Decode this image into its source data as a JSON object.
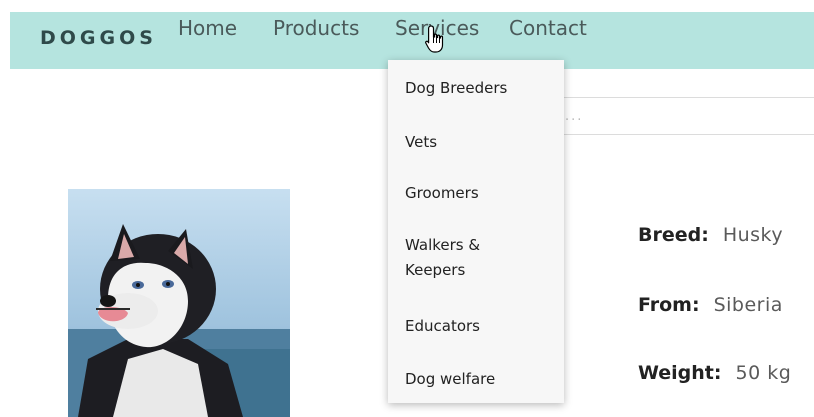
{
  "navbar": {
    "brand": "DOGGOS",
    "links": [
      "Home",
      "Products",
      "Services",
      "Contact"
    ]
  },
  "search": {
    "placeholder": "Search..."
  },
  "services_dropdown": {
    "items": [
      "Dog Breeders",
      "Vets",
      "Groomers",
      "Walkers & Keepers",
      "Educators",
      "Dog welfare"
    ]
  },
  "dog_info": {
    "breed_label": "Breed:",
    "breed_value": "Husky",
    "from_label": "From:",
    "from_value": "Siberia",
    "weight_label": "Weight:",
    "weight_value": "50 kg"
  },
  "colors": {
    "navbar_bg": "#b5e4df",
    "dropdown_bg": "#f7f7f7"
  },
  "icons": {
    "cursor": "hand-pointer-icon"
  }
}
